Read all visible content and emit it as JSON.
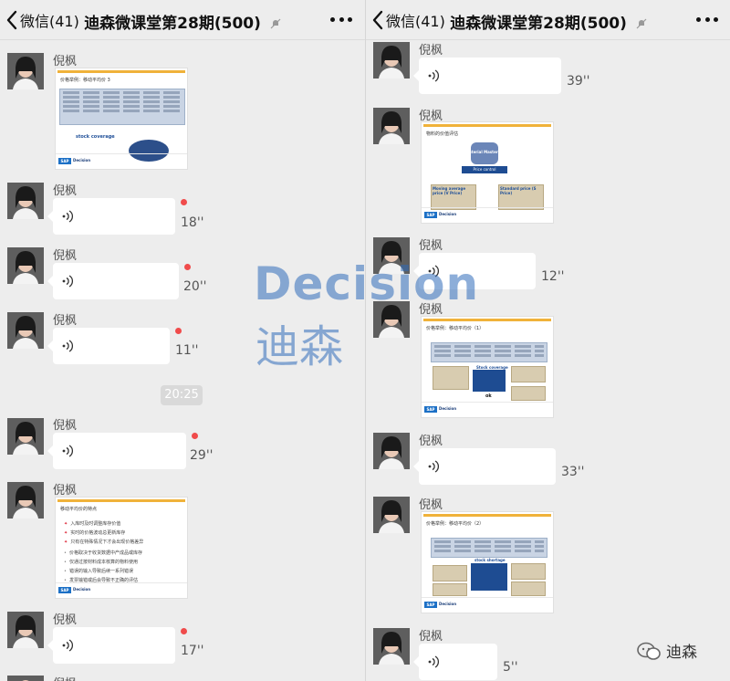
{
  "header": {
    "back_label": "微信(41)",
    "title": "迪森微课堂第28期(500)"
  },
  "watermark": {
    "en": "Decision",
    "cn": "迪森"
  },
  "brand": {
    "name": "迪森"
  },
  "left": {
    "messages": [
      {
        "sender": "倪枫",
        "type": "image",
        "slide_title": "价格举例：移动平均价 3"
      },
      {
        "sender": "倪枫",
        "type": "voice",
        "duration": "18''",
        "unread": true
      },
      {
        "sender": "倪枫",
        "type": "voice",
        "duration": "20''",
        "unread": true
      },
      {
        "sender": "倪枫",
        "type": "voice",
        "duration": "11''",
        "unread": true
      },
      {
        "type": "time",
        "text": "20:25"
      },
      {
        "sender": "倪枫",
        "type": "voice",
        "duration": "29''",
        "unread": true
      },
      {
        "sender": "倪枫",
        "type": "image",
        "slide_title": "移动平均价的特点"
      },
      {
        "sender": "倪枫",
        "type": "voice",
        "duration": "17''",
        "unread": true
      },
      {
        "sender": "倪枫"
      }
    ]
  },
  "right": {
    "messages": [
      {
        "sender": "倪枫",
        "type": "voice",
        "duration": "39''"
      },
      {
        "sender": "倪枫",
        "type": "image",
        "slide_title": "物料的价值评估"
      },
      {
        "sender": "倪枫",
        "type": "voice",
        "duration": "12''"
      },
      {
        "sender": "倪枫",
        "type": "image",
        "slide_title": "价格举例：移动平均价（1）"
      },
      {
        "sender": "倪枫",
        "type": "voice",
        "duration": "33''"
      },
      {
        "sender": "倪枫",
        "type": "image",
        "slide_title": "价格举例：移动平均价（2）"
      },
      {
        "sender": "倪枫",
        "type": "voice",
        "duration": "5''"
      }
    ]
  },
  "slides": {
    "s1": {
      "label_stock": "stock coverage",
      "footer": "Decision"
    },
    "s2": {
      "items": [
        "入库时及时调整库存价值",
        "实时的价格波动总更新库存",
        "只有在特殊情况下才会出现价格差异",
        "价格取决于收货数据中产成品或库存",
        "仅通过按材料成本核算的物料使用",
        "错误的输入导致后续一系列错误",
        "发票输错或后会导致不正确的评估"
      ],
      "footer": "Decision"
    },
    "s3": {
      "center": "Material Master",
      "control": "Price control",
      "v": "Moving average price (V Price)",
      "s": "Standard price (S Price)",
      "footer": "Decision"
    },
    "s4": {
      "stock": "Stock coverage",
      "ok": "ok",
      "footer": "Decision"
    },
    "s5": {
      "stock": "stock shortage",
      "footer": "Decision"
    }
  },
  "colors": {
    "background": "#ededed",
    "unread_dot": "#f04b4b",
    "watermark": "#306cba",
    "slide_accent": "#f0b23a"
  },
  "icons": [
    "back-chevron-icon",
    "mute-bell-icon",
    "more-icon",
    "voice-wave-icon",
    "brand-logo-icon"
  ]
}
